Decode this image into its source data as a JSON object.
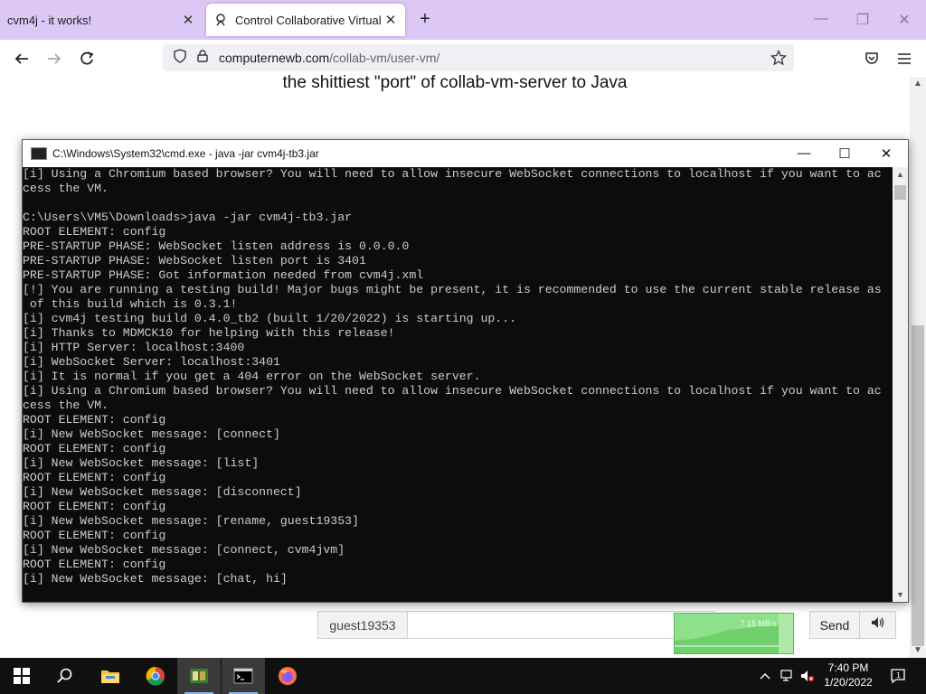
{
  "browser": {
    "tabs": [
      {
        "title": "cvm4j - it works!",
        "active": false
      },
      {
        "title": "Control Collaborative Virtual M",
        "active": true
      }
    ],
    "url_domain": "computernewb.com",
    "url_path": "/collab-vm/user-vm/"
  },
  "page": {
    "heading": "the shittiest \"port\" of collab-vm-server to Java",
    "chat": {
      "username": "guest19353",
      "input_value": "",
      "send_label": "Send"
    },
    "netmeter": {
      "rate": "7.15 MB/s"
    }
  },
  "cmd": {
    "title": "C:\\Windows\\System32\\cmd.exe - java  -jar cvm4j-tb3.jar",
    "lines": [
      "[i] Using a Chromium based browser? You will need to allow insecure WebSocket connections to localhost if you want to ac",
      "cess the VM.",
      "",
      "C:\\Users\\VM5\\Downloads>java -jar cvm4j-tb3.jar",
      "ROOT ELEMENT: config",
      "PRE-STARTUP PHASE: WebSocket listen address is 0.0.0.0",
      "PRE-STARTUP PHASE: WebSocket listen port is 3401",
      "PRE-STARTUP PHASE: Got information needed from cvm4j.xml",
      "[!] You are running a testing build! Major bugs might be present, it is recommended to use the current stable release as",
      " of this build which is 0.3.1!",
      "[i] cvm4j testing build 0.4.0_tb2 (built 1/20/2022) is starting up...",
      "[i] Thanks to MDMCK10 for helping with this release!",
      "[i] HTTP Server: localhost:3400",
      "[i] WebSocket Server: localhost:3401",
      "[i] It is normal if you get a 404 error on the WebSocket server.",
      "[i] Using a Chromium based browser? You will need to allow insecure WebSocket connections to localhost if you want to ac",
      "cess the VM.",
      "ROOT ELEMENT: config",
      "[i] New WebSocket message: [connect]",
      "ROOT ELEMENT: config",
      "[i] New WebSocket message: [list]",
      "ROOT ELEMENT: config",
      "[i] New WebSocket message: [disconnect]",
      "ROOT ELEMENT: config",
      "[i] New WebSocket message: [rename, guest19353]",
      "ROOT ELEMENT: config",
      "[i] New WebSocket message: [connect, cvm4jvm]",
      "ROOT ELEMENT: config",
      "[i] New WebSocket message: [chat, hi]",
      ""
    ]
  },
  "taskbar": {
    "apps": [
      "start-button",
      "search-icon",
      "file-explorer-icon",
      "chrome-icon",
      "green-app-icon",
      "cmd-icon",
      "firefox-icon"
    ],
    "active_app": "cmd-icon",
    "time": "7:40 PM",
    "date": "1/20/2022"
  },
  "colors": {
    "tabbar": "#ddc7f4",
    "cmd_bg": "#0c0c0c",
    "cmd_text": "#cccccc",
    "taskbar": "#101010"
  }
}
